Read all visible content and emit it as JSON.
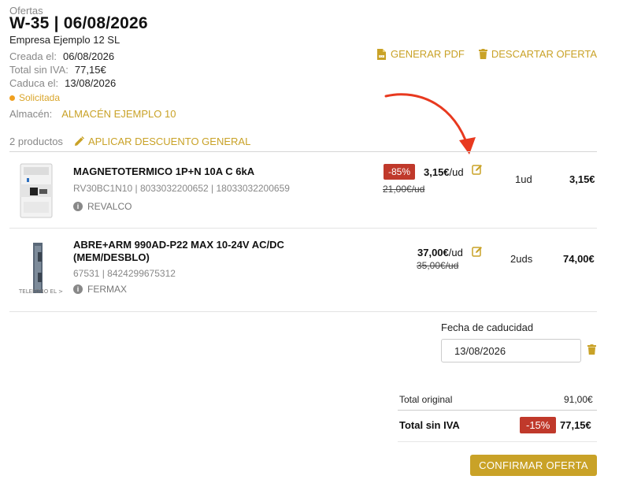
{
  "header": {
    "breadcrumb": "Ofertas",
    "title": "W-35 | 06/08/2026",
    "company": "Empresa Ejemplo 12 SL",
    "created_label": "Creada el:",
    "created_value": "06/08/2026",
    "total_label": "Total sin IVA:",
    "total_value": "77,15€",
    "expires_label": "Caduca el:",
    "expires_value": "13/08/2026",
    "status": "Solicitada",
    "warehouse_label": "Almacén:",
    "warehouse_value": "ALMACÉN EJEMPLO 10",
    "generate_pdf": "GENERAR PDF",
    "discard_offer": "DESCARTAR OFERTA"
  },
  "products_bar": {
    "count": "2 productos",
    "apply_discount": "APLICAR DESCUENTO GENERAL"
  },
  "products": [
    {
      "name": "MAGNETOTERMICO 1P+N 10A C 6kA",
      "codes": "RV30BC1N10 | 8033032200652 | 18033032200659",
      "brand": "REVALCO",
      "discount": "-85%",
      "unit_price": "3,15€",
      "unit_suffix": "/ud",
      "old_price": "21,00€/ud",
      "qty": "1ud",
      "total": "3,15€"
    },
    {
      "name_line1": "ABRE+ARM 990AD-P22 MAX 10-24V AC/DC",
      "name_line2": "(MEM/DESBLO)",
      "codes": "67531 | 8424299675312",
      "brand": "FERMAX",
      "thumb_caption": "TELEFONO EL >",
      "unit_price": "37,00€",
      "unit_suffix": "/ud",
      "old_price": "35,00€/ud",
      "qty": "2uds",
      "total": "74,00€"
    }
  ],
  "expiry": {
    "label": "Fecha de caducidad",
    "value": "13/08/2026"
  },
  "totals": {
    "original_label": "Total original",
    "original_value": "91,00€",
    "net_label": "Total sin IVA",
    "net_discount": "-15%",
    "net_value": "77,15€"
  },
  "confirm_button": "CONFIRMAR OFERTA",
  "colors": {
    "accent": "#c9a227",
    "discount_red": "#c0392b",
    "annotation_arrow": "#e8391f",
    "status_dot": "#f0a020"
  }
}
